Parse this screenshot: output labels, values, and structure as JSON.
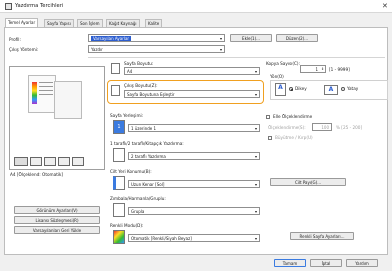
{
  "window": {
    "title": "Yazdırma Tercihleri",
    "close_glyph": "✕"
  },
  "tabs": [
    {
      "label": "Temel Ayarlar"
    },
    {
      "label": "Sayfa Yapısı"
    },
    {
      "label": "Son İşlem"
    },
    {
      "label": "Kağıt Kaynağı"
    },
    {
      "label": "Kalite"
    }
  ],
  "profile": {
    "label": "Profil:",
    "value": "Varsayılan Ayarlar",
    "add_label": "Ekle(1)...",
    "edit_label": "Düzen(2)..."
  },
  "output_method": {
    "label": "Çıkış Yöntemi:",
    "value": "Yazdır"
  },
  "preview": {
    "caption": "A4 [Ölçeklend: Otomatik]"
  },
  "left_buttons": {
    "settings_view": "Görünüm Ayarları(V)",
    "license": "Lisansı Sözleşmesi(R)",
    "restore_defaults": "Varsayılanları Geri Yükle"
  },
  "page_size": {
    "label": "Sayfa Boyutu:",
    "value": "A4"
  },
  "output_size": {
    "label": "Çıkış Boyutu(Z):",
    "value": "Sayfa Boyutuna Eşleştir"
  },
  "copies": {
    "label": "Kopya Sayısı(C):",
    "value": "1",
    "range": "[1 - 9999]"
  },
  "orientation": {
    "label": "Yön(O)",
    "portrait": "Dikey",
    "landscape": "Yatay",
    "icon_letter": "A"
  },
  "manual_scaling": {
    "label": "Elle Ölçeklendirme",
    "scale_label": "Ölçeklendirme(S):",
    "scale_value": "100",
    "scale_range": "% [25 - 200]",
    "booklet_label": "Büyütme / Kırp(U)"
  },
  "page_layout": {
    "label": "Sayfa Yerleşimi:",
    "value": "1 üzerinde 1",
    "icon_text": "1"
  },
  "duplex": {
    "label": "1 taraflı/2 taraflı/Kitapçık Yazdırma:",
    "value": "2 taraflı Yazdırma"
  },
  "binding": {
    "label": "Cilt Yeri Konumu(B):",
    "value": "Uzun Kenar [Sol]",
    "button": "Cilt Payı(G)..."
  },
  "finishing": {
    "label": "Zımbala/Harmanla/Gruplu:",
    "value": "Grupla"
  },
  "color_mode": {
    "label": "Renkli Modu(D):",
    "value": "Otomatik [Renkli/Siyah Beyaz]",
    "button": "Renkli Sayfa Ayarları..."
  },
  "footer": {
    "ok": "Tamam",
    "cancel": "İptal",
    "help": "Yardım"
  }
}
